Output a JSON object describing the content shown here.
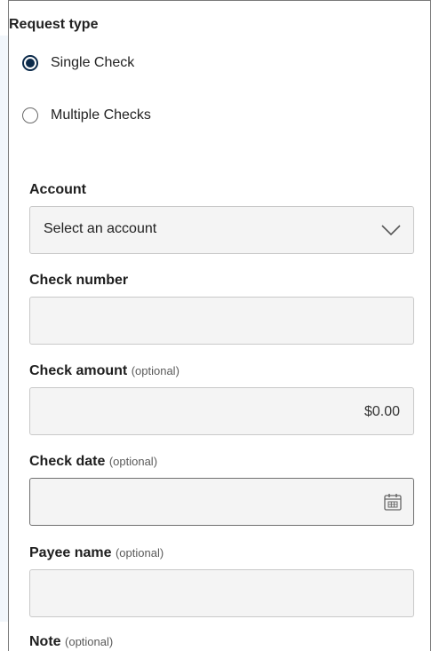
{
  "request_type": {
    "title": "Request type",
    "options": [
      {
        "label": "Single Check",
        "checked": true
      },
      {
        "label": "Multiple Checks",
        "checked": false
      }
    ]
  },
  "account": {
    "label": "Account",
    "selected_value": "Select an account",
    "icon": "chevron-down-icon"
  },
  "check_number": {
    "label": "Check number",
    "value": ""
  },
  "check_amount": {
    "label": "Check amount",
    "optional_label": "(optional)",
    "value": "$0.00"
  },
  "check_date": {
    "label": "Check date",
    "optional_label": "(optional)",
    "value": "",
    "icon": "calendar-icon"
  },
  "payee_name": {
    "label": "Payee name",
    "optional_label": "(optional)",
    "value": ""
  },
  "note": {
    "label": "Note",
    "optional_label": "(optional)"
  },
  "colors": {
    "radio_selected": "#0b2a4a",
    "field_background": "#f4f4f4",
    "field_border": "#c9c9c9"
  }
}
